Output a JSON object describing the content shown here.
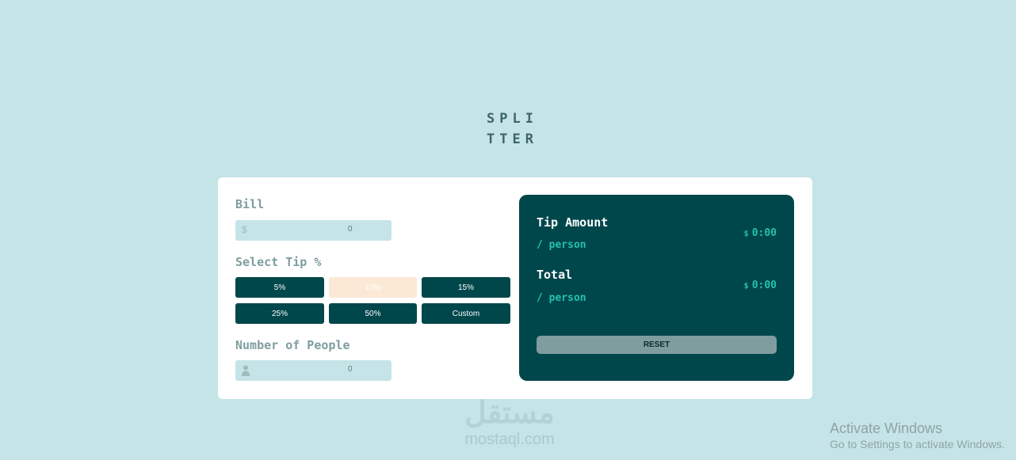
{
  "logo": {
    "line1": "SPLI",
    "line2": "TTER"
  },
  "bill": {
    "label": "Bill",
    "currency_symbol": "$",
    "value": "0"
  },
  "tip": {
    "label": "Select Tip %",
    "options": [
      "5%",
      "10%",
      "15%",
      "25%",
      "50%",
      "Custom"
    ],
    "selected": "10%"
  },
  "people": {
    "label": "Number of People",
    "icon": "person-icon",
    "value": "0"
  },
  "results": {
    "tip_amount": {
      "title": "Tip Amount",
      "sub": "/ person",
      "currency": "$",
      "value": "0:00"
    },
    "total": {
      "title": "Total",
      "sub": "/ person",
      "currency": "$",
      "value": "0:00"
    },
    "reset_label": "RESET"
  },
  "watermark": {
    "arabic": "مستقل",
    "latin": "mostaql.com"
  },
  "os_overlay": {
    "line1": "Activate Windows",
    "line2": "Go to Settings to activate Windows."
  },
  "colors": {
    "background": "#c5e4e7",
    "dark_cyan": "#00474b",
    "strong_cyan": "#26c0ab",
    "selected_tip": "#fbe9d6",
    "reset_button": "#7f9c9f"
  }
}
